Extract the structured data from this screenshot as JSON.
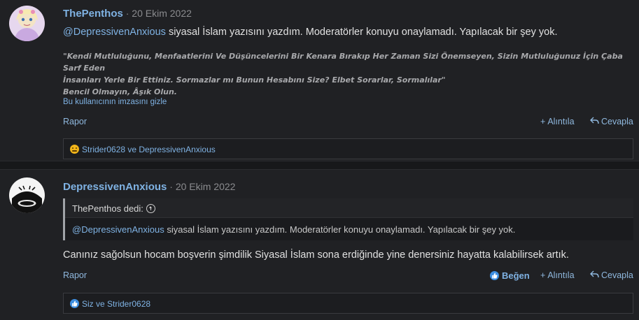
{
  "posts": [
    {
      "username": "ThePenthos",
      "separator": "·",
      "date": "20 Ekim 2022",
      "mention": "@DepressivenAnxious",
      "message": "siyasal İslam yazısını yazdım. Moderatörler konuyu onaylamadı. Yapılacak bir şey yok.",
      "signature_quote_line1": "\"Kendi Mutluluğunu, Menfaatlerini Ve Düşüncelerini Bir Kenara Bırakıp Her Zaman Sizi Önemseyen, Sizin Mutluluğunuz İçin Çaba Sarf Eden",
      "signature_quote_line2": "İnsanları Yerle Bir Ettiniz. Sormazlar mı Bunun Hesabını Size? Elbet Sorarlar, Sormalılar\"",
      "signature_motto": "Bencil Olmayın, Âşık Olun.",
      "signature_toggle": "Bu kullanıcının imzasını gizle",
      "report_label": "Rapor",
      "quote_label": "Alıntıla",
      "reply_label": "Cevapla",
      "reactions_text": "Strider0628 ve DepressivenAnxious",
      "reaction_icon": "sad-emoji-icon"
    },
    {
      "username": "DepressivenAnxious",
      "separator": "·",
      "date": "20 Ekim 2022",
      "quote_author": "ThePenthos dedi:",
      "quote_mention": "@DepressivenAnxious",
      "quote_text": "siyasal İslam yazısını yazdım. Moderatörler konuyu onaylamadı. Yapılacak bir şey yok.",
      "message": "Canınız sağolsun hocam boşverin şimdilik Siyasal İslam sona erdiğinde yine denersiniz hayatta kalabilirsek artık.",
      "report_label": "Rapor",
      "like_label": "Beğen",
      "quote_label": "Alıntıla",
      "reply_label": "Cevapla",
      "reactions_text": "Siz ve Strider0628",
      "reaction_icon": "like-icon"
    }
  ],
  "colors": {
    "background": "#202124",
    "link": "#7fb2e3",
    "text": "#e1e1e1",
    "muted": "#8a8b8e"
  }
}
